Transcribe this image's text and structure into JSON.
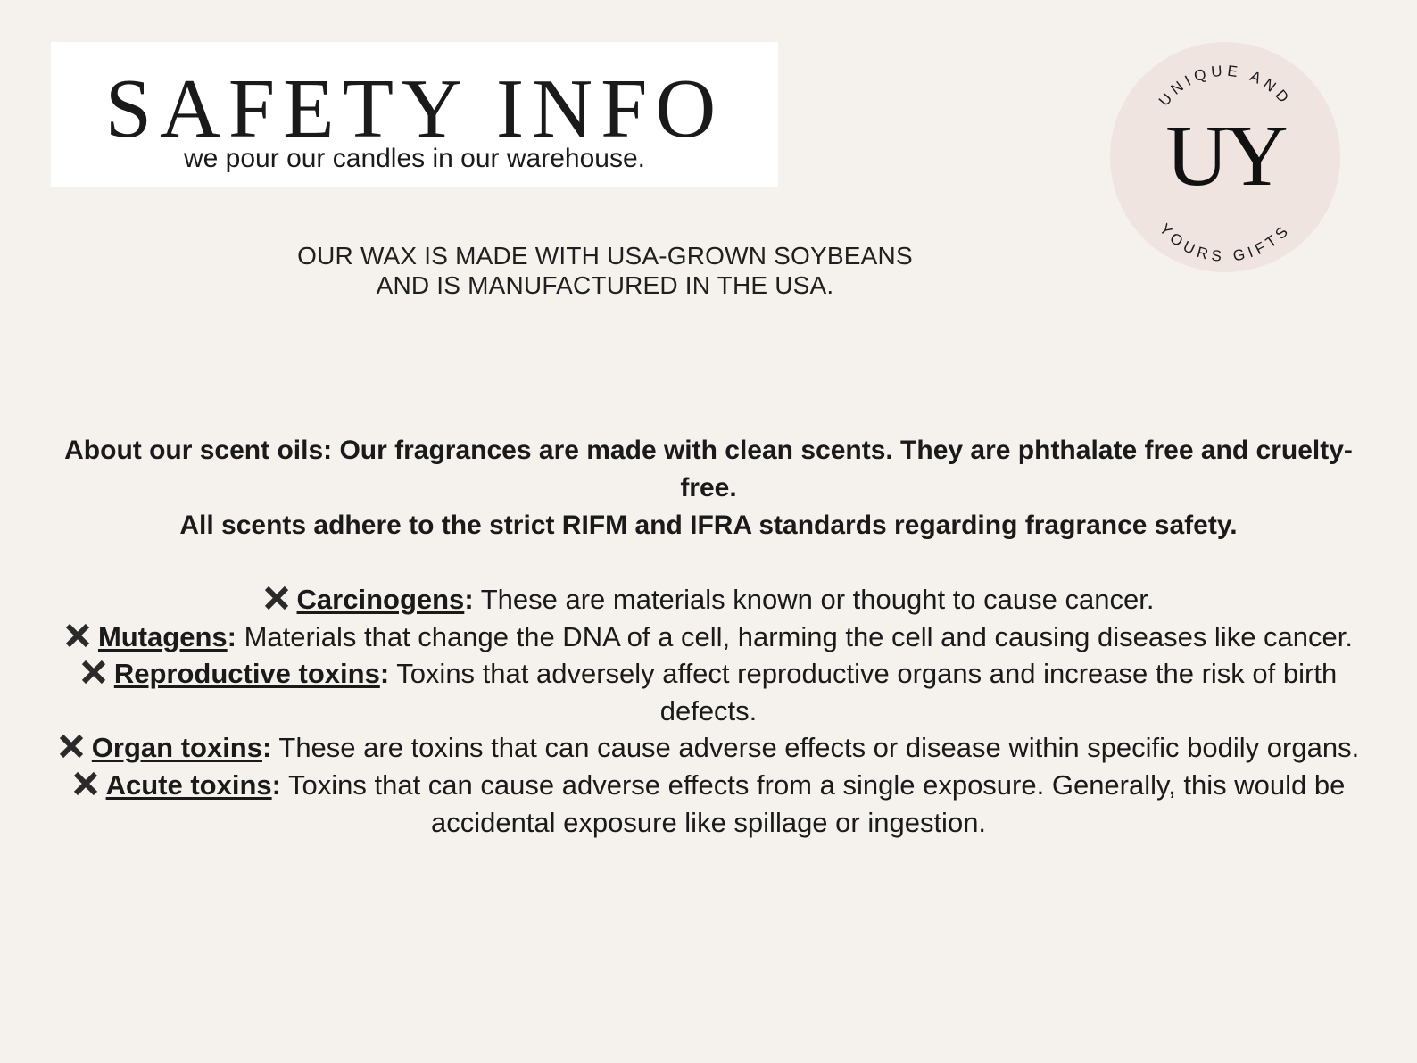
{
  "header": {
    "title": "SAFETY INFO",
    "subtitle": "we pour our candles in our warehouse."
  },
  "logo": {
    "ring_text": "UNIQUE AND YOURS GIFTS",
    "top_text": "UNIQUE AND",
    "bottom_text": "YOURS GIFTS",
    "monogram": "UY",
    "bg_color": "#f0e4e1"
  },
  "wax_note": {
    "line1": "OUR WAX IS MADE WITH USA-GROWN SOYBEANS",
    "line2": "AND IS MANUFACTURED IN THE USA."
  },
  "scent_oils": {
    "line1": "About our scent oils: Our fragrances are made with clean scents. They are phthalate free and cruelty- free.",
    "line2": "All scents adhere to the strict RIFM and IFRA standards regarding fragrance safety."
  },
  "hazards": [
    {
      "icon": "x-mark-icon",
      "term": "Carcinogens",
      "colon": ":",
      "text": " These are materials known or thought to cause cancer."
    },
    {
      "icon": "x-mark-icon",
      "term": "Mutagens",
      "colon": ":",
      "text": " Materials that change the DNA of a cell, harming the cell and causing diseases like cancer."
    },
    {
      "icon": "x-mark-icon",
      "term": "Reproductive toxins",
      "colon": ":",
      "text": " Toxins that adversely affect reproductive organs and increase the risk of birth defects."
    },
    {
      "icon": "x-mark-icon",
      "term": "Organ toxins",
      "colon": ":",
      "text": " These are toxins that can cause adverse effects or disease within specific bodily organs."
    },
    {
      "icon": "x-mark-icon",
      "term": "Acute toxins",
      "colon": ":",
      "text": " Toxins that can cause adverse effects from a single exposure. Generally, this would be accidental exposure like spillage or ingestion."
    }
  ],
  "colors": {
    "background": "#f5f1ed",
    "title_box": "#ffffff",
    "text": "#1a1a1a",
    "icon": "#2a2a2a"
  }
}
